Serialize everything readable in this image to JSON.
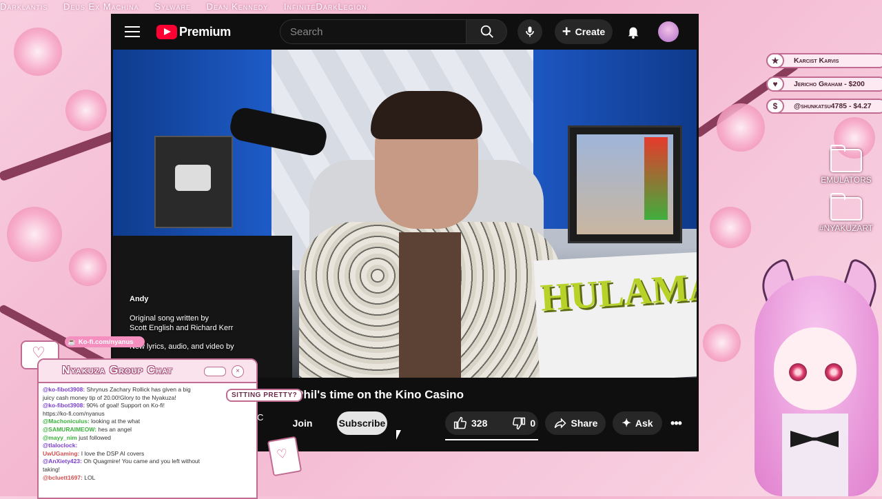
{
  "ticker": [
    "Darklantis",
    "Deus Ex Machina",
    "Sylware",
    "Dean Kennedy",
    "InfiniteDarkLegion"
  ],
  "youtube": {
    "logo_text": "Premium",
    "search_placeholder": "Search",
    "create_label": "Create",
    "video_overlay": {
      "name": "Andy",
      "credit_line1": "Original song written by",
      "credit_line2": "Scott English and Richard Kerr",
      "credit_line3": "New lyrics, audio, and video by"
    },
    "title": "Phil's time on the Kino Casino",
    "channel_fragment": "C",
    "join_label": "Join",
    "subscribe_label": "Subscribe",
    "like_count": "328",
    "dislike_count": "0",
    "share_label": "Share",
    "ask_label": "Ask"
  },
  "donations": [
    {
      "icon": "★",
      "icon_name": "star-icon",
      "text": "Karcist Karvis"
    },
    {
      "icon": "♥",
      "icon_name": "heart-icon",
      "text": "Jericho Graham - $200"
    },
    {
      "icon": "$",
      "icon_name": "dollar-icon",
      "text": "@shunkatsu4785 - $4.27"
    }
  ],
  "folders": [
    {
      "label": "EMULATORS"
    },
    {
      "label": "#NYAKUZART"
    }
  ],
  "chat": {
    "kofi": "Ko-fi.com/nyanus",
    "title": "Nyakuza Group Chat",
    "sitting_label": "SITTING PRETTY?",
    "messages": [
      {
        "user": "@ko-fibot3908:",
        "text": "Shrynus Zachary Rollick has given a big",
        "cls": "u"
      },
      {
        "user": "",
        "text": "juicy cash money tip of 20.00!Glory to the Nyakuza!",
        "cls": "u"
      },
      {
        "user": "@ko-fibot3908:",
        "text": "90% of goal! Support on Ko-fi!",
        "cls": "u"
      },
      {
        "user": "",
        "text": "https://ko-fi.com/nyanus",
        "cls": "u"
      },
      {
        "user": "@Machoniculus:",
        "text": "looking at the what",
        "cls": "g"
      },
      {
        "user": "@SAMURAIMEOW:",
        "text": "hes an angel",
        "cls": "g"
      },
      {
        "user": "@mayy_nim",
        "text": "just followed",
        "cls": "g"
      },
      {
        "user": "@tlaloclock:",
        "text": "",
        "cls": "u"
      },
      {
        "user": "UwUGaming:",
        "text": "I love the DSP AI covers",
        "cls": "r"
      },
      {
        "user": "@AnXiety423:",
        "text": "Oh Quagmire! You came and you left without",
        "cls": "u"
      },
      {
        "user": "",
        "text": "taking!",
        "cls": "u"
      },
      {
        "user": "@bcluett1697:",
        "text": "LOL",
        "cls": "r"
      }
    ]
  }
}
